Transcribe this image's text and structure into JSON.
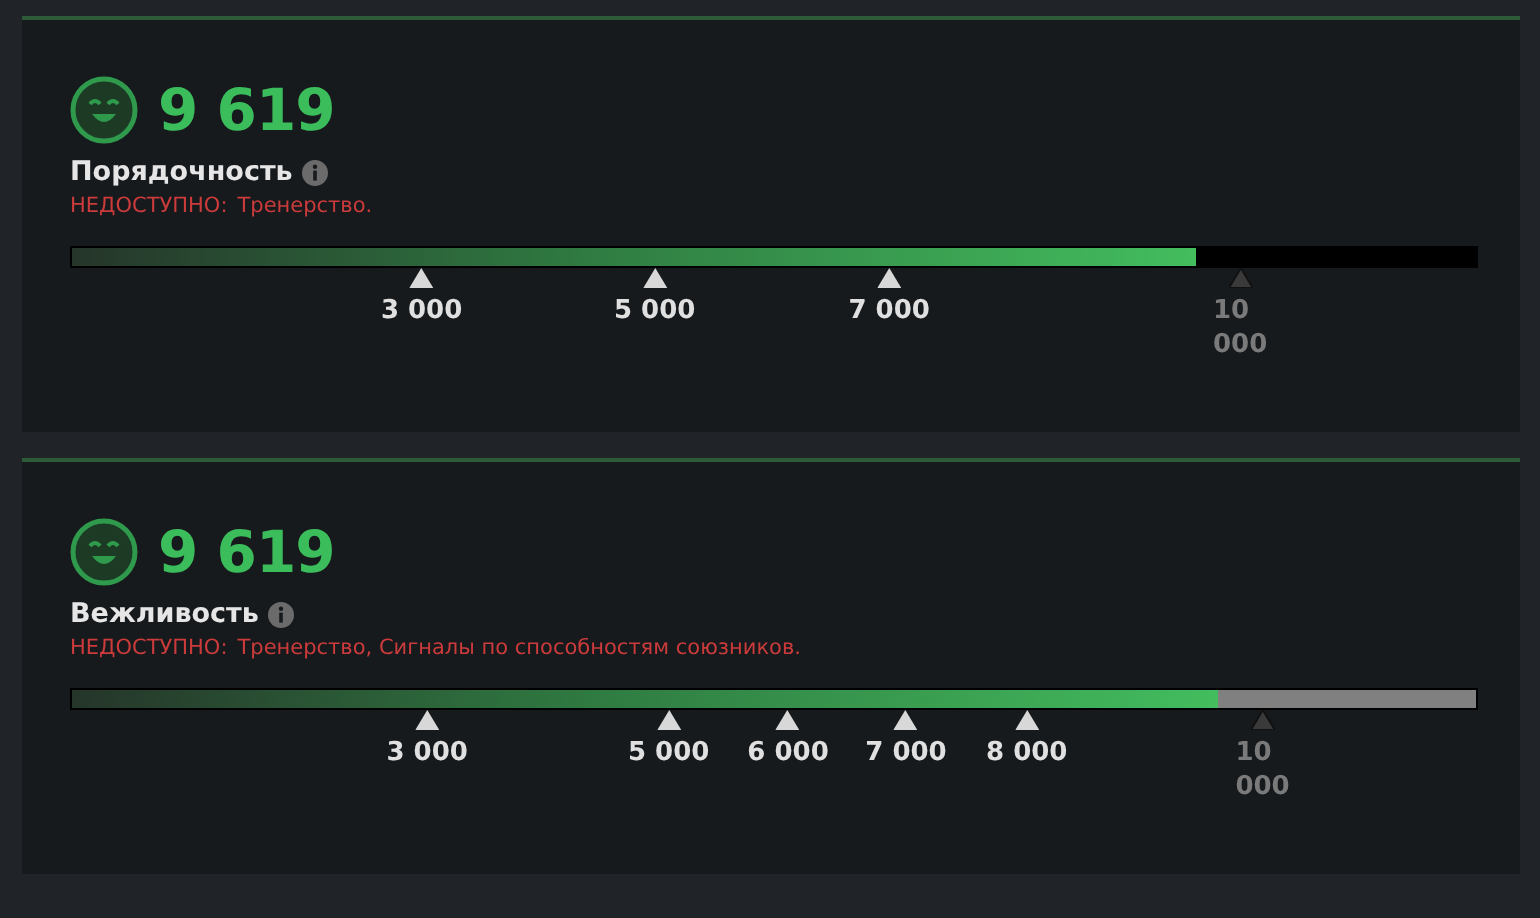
{
  "panels": [
    {
      "score": "9 619",
      "title": "Порядочность",
      "unavailable_label": "НЕДОСТУПНО:",
      "unavailable_items": "Тренерство.",
      "bar": {
        "level": 0.801,
        "color": "#000000",
        "ticks": [
          {
            "label": "3 000",
            "level": 0.249,
            "reached": true
          },
          {
            "label": "5 000",
            "level": 0.415,
            "reached": true
          },
          {
            "label": "7 000",
            "level": 0.582,
            "reached": true
          },
          {
            "label": "10 000",
            "level": 0.832,
            "reached": false
          }
        ]
      }
    },
    {
      "score": "9 619",
      "title": "Вежливость",
      "unavailable_label": "НЕДОСТУПНО:",
      "unavailable_items": "Тренерство, Сигналы по способностям союзников.",
      "bar": {
        "level": 0.816,
        "color": "#808080",
        "ticks": [
          {
            "label": "3 000",
            "level": 0.253,
            "reached": true
          },
          {
            "label": "5 000",
            "level": 0.425,
            "reached": true
          },
          {
            "label": "6 000",
            "level": 0.51,
            "reached": true
          },
          {
            "label": "7 000",
            "level": 0.594,
            "reached": true
          },
          {
            "label": "8 000",
            "level": 0.68,
            "reached": true
          },
          {
            "label": "10 000",
            "level": 0.848,
            "reached": false
          }
        ]
      }
    }
  ]
}
